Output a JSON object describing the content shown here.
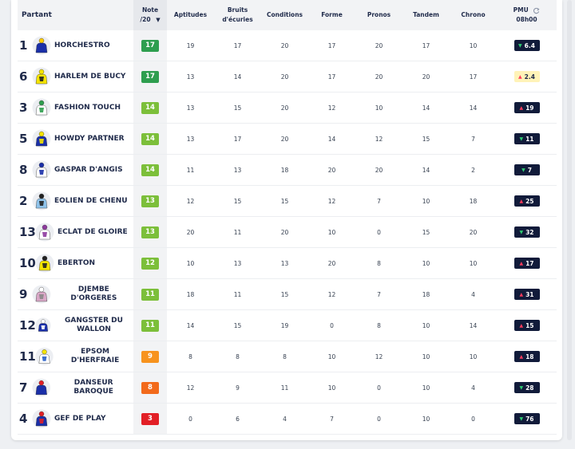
{
  "header": {
    "partant": "Partant",
    "note_line1": "Note",
    "note_line2": "/20",
    "aptitudes": "Aptitudes",
    "bruits_line1": "Bruits",
    "bruits_line2": "d'écuries",
    "conditions": "Conditions",
    "forme": "Forme",
    "pronos": "Pronos",
    "tandem": "Tandem",
    "chrono": "Chrono",
    "pmu_line1": "PMU",
    "pmu_line2": "08h00"
  },
  "colors": {
    "green_dark": "#2e9e4f",
    "green_light": "#7cbf3a",
    "orange": "#f7931e",
    "orange_dark": "#f26a1b",
    "red": "#e21f26"
  },
  "rows": [
    {
      "num": "1",
      "name": "HORCHESTRO",
      "note": "17",
      "note_color": "#2e9e4f",
      "aptitudes": "19",
      "bruits": "17",
      "conditions": "20",
      "forme": "17",
      "pronos": "20",
      "tandem": "17",
      "chrono": "10",
      "pmu": "6.4",
      "pmu_trend": "down",
      "pmu_style": "dark",
      "silk": {
        "c1": "#1a2fa8",
        "c2": "#1a2fa8",
        "accent": "#ffcc00"
      }
    },
    {
      "num": "6",
      "name": "HARLEM DE BUCY",
      "note": "17",
      "note_color": "#2e9e4f",
      "aptitudes": "13",
      "bruits": "14",
      "conditions": "20",
      "forme": "17",
      "pronos": "20",
      "tandem": "20",
      "chrono": "17",
      "pmu": "2.4",
      "pmu_trend": "up",
      "pmu_style": "yellow",
      "silk": {
        "c1": "#f5e400",
        "c2": "#222222",
        "accent": "#f5e400"
      }
    },
    {
      "num": "3",
      "name": "FASHION TOUCH",
      "note": "14",
      "note_color": "#7cbf3a",
      "aptitudes": "13",
      "bruits": "15",
      "conditions": "20",
      "forme": "12",
      "pronos": "10",
      "tandem": "14",
      "chrono": "14",
      "pmu": "19",
      "pmu_trend": "up",
      "pmu_style": "dark",
      "silk": {
        "c1": "#ffffff",
        "c2": "#2e9e4f",
        "accent": "#2e9e4f"
      }
    },
    {
      "num": "5",
      "name": "HOWDY PARTNER",
      "note": "14",
      "note_color": "#7cbf3a",
      "aptitudes": "13",
      "bruits": "17",
      "conditions": "20",
      "forme": "14",
      "pronos": "12",
      "tandem": "15",
      "chrono": "7",
      "pmu": "11",
      "pmu_trend": "down",
      "pmu_style": "dark",
      "silk": {
        "c1": "#1a2fa8",
        "c2": "#f5e400",
        "accent": "#f5e400"
      }
    },
    {
      "num": "8",
      "name": "GASPAR D'ANGIS",
      "note": "14",
      "note_color": "#7cbf3a",
      "aptitudes": "11",
      "bruits": "13",
      "conditions": "18",
      "forme": "20",
      "pronos": "20",
      "tandem": "14",
      "chrono": "2",
      "pmu": "7",
      "pmu_trend": "down",
      "pmu_style": "dark",
      "silk": {
        "c1": "#ffffff",
        "c2": "#1a2fa8",
        "accent": "#1a2fa8"
      }
    },
    {
      "num": "2",
      "name": "EOLIEN DE CHENU",
      "note": "13",
      "note_color": "#7cbf3a",
      "aptitudes": "12",
      "bruits": "15",
      "conditions": "15",
      "forme": "12",
      "pronos": "7",
      "tandem": "10",
      "chrono": "18",
      "pmu": "25",
      "pmu_trend": "up",
      "pmu_style": "dark",
      "silk": {
        "c1": "#8fc3ea",
        "c2": "#222222",
        "accent": "#222222"
      }
    },
    {
      "num": "13",
      "name": "ECLAT DE GLOIRE",
      "note": "13",
      "note_color": "#7cbf3a",
      "aptitudes": "20",
      "bruits": "11",
      "conditions": "20",
      "forme": "10",
      "pronos": "0",
      "tandem": "15",
      "chrono": "20",
      "pmu": "32",
      "pmu_trend": "down",
      "pmu_style": "dark",
      "silk": {
        "c1": "#ffffff",
        "c2": "#8e3a9e",
        "accent": "#8e3a9e"
      }
    },
    {
      "num": "10",
      "name": "EBERTON",
      "note": "12",
      "note_color": "#7cbf3a",
      "aptitudes": "10",
      "bruits": "13",
      "conditions": "13",
      "forme": "20",
      "pronos": "8",
      "tandem": "10",
      "chrono": "10",
      "pmu": "17",
      "pmu_trend": "up",
      "pmu_style": "dark",
      "silk": {
        "c1": "#f5e400",
        "c2": "#222222",
        "accent": "#222222"
      }
    },
    {
      "num": "9",
      "name": "DJEMBE D'ORGERES",
      "note": "11",
      "note_color": "#7cbf3a",
      "aptitudes": "18",
      "bruits": "11",
      "conditions": "15",
      "forme": "12",
      "pronos": "7",
      "tandem": "18",
      "chrono": "4",
      "pmu": "31",
      "pmu_trend": "up",
      "pmu_style": "dark",
      "silk": {
        "c1": "#d9a7c7",
        "c2": "#888888",
        "accent": "#ffffff"
      }
    },
    {
      "num": "12",
      "name": "GANGSTER DU WALLON",
      "note": "11",
      "note_color": "#7cbf3a",
      "aptitudes": "14",
      "bruits": "15",
      "conditions": "19",
      "forme": "0",
      "pronos": "8",
      "tandem": "10",
      "chrono": "14",
      "pmu": "15",
      "pmu_trend": "up",
      "pmu_style": "dark",
      "silk": {
        "c1": "#1a2fa8",
        "c2": "#ffffff",
        "accent": "#ffffff"
      }
    },
    {
      "num": "11",
      "name": "EPSOM D'HERFRAIE",
      "note": "9",
      "note_color": "#f7931e",
      "aptitudes": "8",
      "bruits": "8",
      "conditions": "8",
      "forme": "10",
      "pronos": "12",
      "tandem": "10",
      "chrono": "10",
      "pmu": "18",
      "pmu_trend": "up",
      "pmu_style": "dark",
      "silk": {
        "c1": "#ffffff",
        "c2": "#2a60c8",
        "accent": "#f5e400"
      }
    },
    {
      "num": "7",
      "name": "DANSEUR BAROQUE",
      "note": "8",
      "note_color": "#f26a1b",
      "aptitudes": "12",
      "bruits": "9",
      "conditions": "11",
      "forme": "10",
      "pronos": "0",
      "tandem": "10",
      "chrono": "4",
      "pmu": "28",
      "pmu_trend": "down",
      "pmu_style": "dark",
      "silk": {
        "c1": "#1a2fa8",
        "c2": "#1a2fa8",
        "accent": "#e21f26"
      }
    },
    {
      "num": "4",
      "name": "GEF DE PLAY",
      "note": "3",
      "note_color": "#e21f26",
      "aptitudes": "0",
      "bruits": "6",
      "conditions": "4",
      "forme": "7",
      "pronos": "0",
      "tandem": "10",
      "chrono": "0",
      "pmu": "76",
      "pmu_trend": "down",
      "pmu_style": "dark",
      "silk": {
        "c1": "#1a2fa8",
        "c2": "#e21f26",
        "accent": "#e21f26"
      }
    }
  ]
}
